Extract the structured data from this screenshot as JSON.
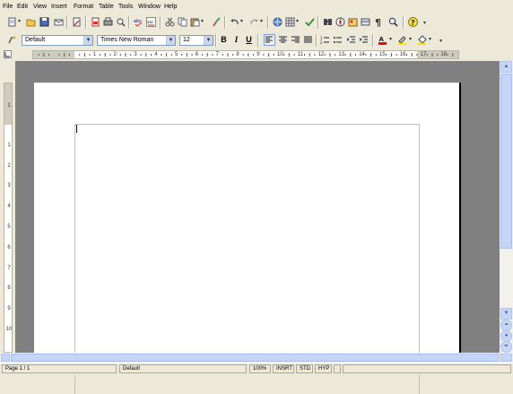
{
  "menu": [
    "File",
    "Edit",
    "View",
    "Insert",
    "Format",
    "Table",
    "Tools",
    "Window",
    "Help"
  ],
  "formatting": {
    "style": "Default",
    "font": "Times New Roman",
    "size": "12",
    "bold": "B",
    "italic": "I",
    "underline": "U"
  },
  "ruler": {
    "h_numbers": [
      "1",
      "2",
      "3",
      "4",
      "5",
      "6",
      "7",
      "8",
      "9",
      "10",
      "11",
      "12",
      "13",
      "14",
      "15",
      "16",
      "17",
      "18"
    ],
    "v_numbers": [
      "1",
      "1",
      "2",
      "3",
      "4",
      "5",
      "6",
      "7",
      "8",
      "9",
      "10"
    ]
  },
  "status": {
    "page": "Page 1 / 1",
    "page_style": "Default",
    "zoom": "100%",
    "insert_mode": "INSRT",
    "selection_mode": "STD",
    "hyperlink_mode": "HYP"
  },
  "colors": {
    "ui_background": "#ece9d8",
    "document_area": "#808080",
    "scrollbar_accent": "#c5d5f7",
    "font_color_red": "#e01010",
    "highlight_yellow": "#f2e600"
  }
}
